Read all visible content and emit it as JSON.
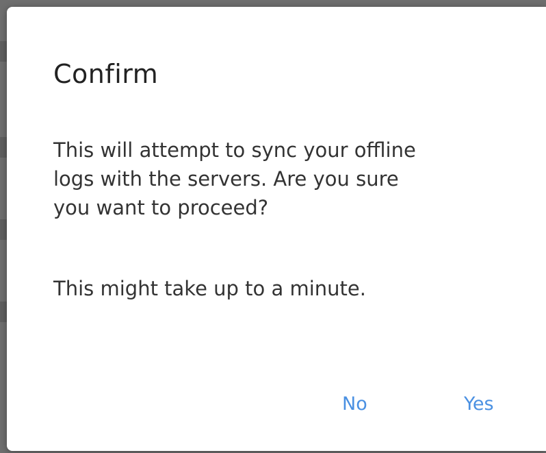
{
  "dialog": {
    "title": "Confirm",
    "message": "This will attempt to sync your offline\nlogs with the servers. Are you sure\nyou want to proceed?",
    "note": "This might take up to a minute.",
    "buttons": {
      "no_label": "No",
      "yes_label": "Yes"
    }
  },
  "colors": {
    "accent": "#4a90e2",
    "backdrop": "#6e6e6e",
    "dialog_background": "#ffffff",
    "text": "#333333"
  }
}
